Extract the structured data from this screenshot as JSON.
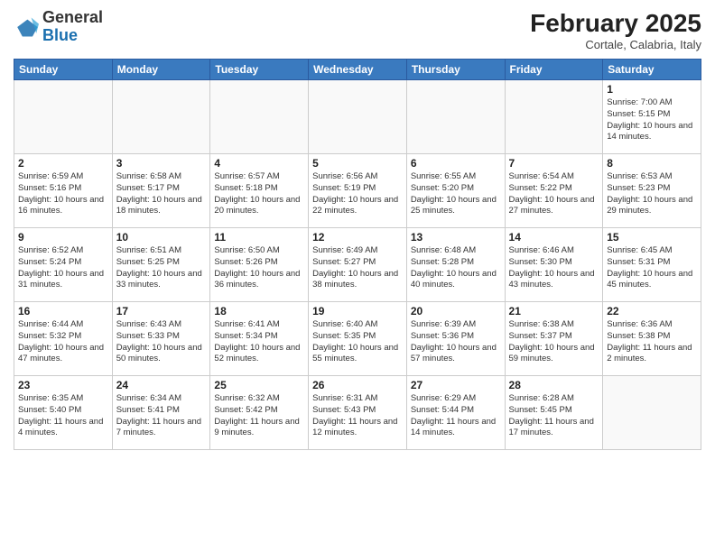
{
  "header": {
    "logo_general": "General",
    "logo_blue": "Blue",
    "month": "February 2025",
    "location": "Cortale, Calabria, Italy"
  },
  "weekdays": [
    "Sunday",
    "Monday",
    "Tuesday",
    "Wednesday",
    "Thursday",
    "Friday",
    "Saturday"
  ],
  "weeks": [
    [
      {
        "day": "",
        "info": ""
      },
      {
        "day": "",
        "info": ""
      },
      {
        "day": "",
        "info": ""
      },
      {
        "day": "",
        "info": ""
      },
      {
        "day": "",
        "info": ""
      },
      {
        "day": "",
        "info": ""
      },
      {
        "day": "1",
        "info": "Sunrise: 7:00 AM\nSunset: 5:15 PM\nDaylight: 10 hours\nand 14 minutes."
      }
    ],
    [
      {
        "day": "2",
        "info": "Sunrise: 6:59 AM\nSunset: 5:16 PM\nDaylight: 10 hours\nand 16 minutes."
      },
      {
        "day": "3",
        "info": "Sunrise: 6:58 AM\nSunset: 5:17 PM\nDaylight: 10 hours\nand 18 minutes."
      },
      {
        "day": "4",
        "info": "Sunrise: 6:57 AM\nSunset: 5:18 PM\nDaylight: 10 hours\nand 20 minutes."
      },
      {
        "day": "5",
        "info": "Sunrise: 6:56 AM\nSunset: 5:19 PM\nDaylight: 10 hours\nand 22 minutes."
      },
      {
        "day": "6",
        "info": "Sunrise: 6:55 AM\nSunset: 5:20 PM\nDaylight: 10 hours\nand 25 minutes."
      },
      {
        "day": "7",
        "info": "Sunrise: 6:54 AM\nSunset: 5:22 PM\nDaylight: 10 hours\nand 27 minutes."
      },
      {
        "day": "8",
        "info": "Sunrise: 6:53 AM\nSunset: 5:23 PM\nDaylight: 10 hours\nand 29 minutes."
      }
    ],
    [
      {
        "day": "9",
        "info": "Sunrise: 6:52 AM\nSunset: 5:24 PM\nDaylight: 10 hours\nand 31 minutes."
      },
      {
        "day": "10",
        "info": "Sunrise: 6:51 AM\nSunset: 5:25 PM\nDaylight: 10 hours\nand 33 minutes."
      },
      {
        "day": "11",
        "info": "Sunrise: 6:50 AM\nSunset: 5:26 PM\nDaylight: 10 hours\nand 36 minutes."
      },
      {
        "day": "12",
        "info": "Sunrise: 6:49 AM\nSunset: 5:27 PM\nDaylight: 10 hours\nand 38 minutes."
      },
      {
        "day": "13",
        "info": "Sunrise: 6:48 AM\nSunset: 5:28 PM\nDaylight: 10 hours\nand 40 minutes."
      },
      {
        "day": "14",
        "info": "Sunrise: 6:46 AM\nSunset: 5:30 PM\nDaylight: 10 hours\nand 43 minutes."
      },
      {
        "day": "15",
        "info": "Sunrise: 6:45 AM\nSunset: 5:31 PM\nDaylight: 10 hours\nand 45 minutes."
      }
    ],
    [
      {
        "day": "16",
        "info": "Sunrise: 6:44 AM\nSunset: 5:32 PM\nDaylight: 10 hours\nand 47 minutes."
      },
      {
        "day": "17",
        "info": "Sunrise: 6:43 AM\nSunset: 5:33 PM\nDaylight: 10 hours\nand 50 minutes."
      },
      {
        "day": "18",
        "info": "Sunrise: 6:41 AM\nSunset: 5:34 PM\nDaylight: 10 hours\nand 52 minutes."
      },
      {
        "day": "19",
        "info": "Sunrise: 6:40 AM\nSunset: 5:35 PM\nDaylight: 10 hours\nand 55 minutes."
      },
      {
        "day": "20",
        "info": "Sunrise: 6:39 AM\nSunset: 5:36 PM\nDaylight: 10 hours\nand 57 minutes."
      },
      {
        "day": "21",
        "info": "Sunrise: 6:38 AM\nSunset: 5:37 PM\nDaylight: 10 hours\nand 59 minutes."
      },
      {
        "day": "22",
        "info": "Sunrise: 6:36 AM\nSunset: 5:38 PM\nDaylight: 11 hours\nand 2 minutes."
      }
    ],
    [
      {
        "day": "23",
        "info": "Sunrise: 6:35 AM\nSunset: 5:40 PM\nDaylight: 11 hours\nand 4 minutes."
      },
      {
        "day": "24",
        "info": "Sunrise: 6:34 AM\nSunset: 5:41 PM\nDaylight: 11 hours\nand 7 minutes."
      },
      {
        "day": "25",
        "info": "Sunrise: 6:32 AM\nSunset: 5:42 PM\nDaylight: 11 hours\nand 9 minutes."
      },
      {
        "day": "26",
        "info": "Sunrise: 6:31 AM\nSunset: 5:43 PM\nDaylight: 11 hours\nand 12 minutes."
      },
      {
        "day": "27",
        "info": "Sunrise: 6:29 AM\nSunset: 5:44 PM\nDaylight: 11 hours\nand 14 minutes."
      },
      {
        "day": "28",
        "info": "Sunrise: 6:28 AM\nSunset: 5:45 PM\nDaylight: 11 hours\nand 17 minutes."
      },
      {
        "day": "",
        "info": ""
      }
    ]
  ]
}
